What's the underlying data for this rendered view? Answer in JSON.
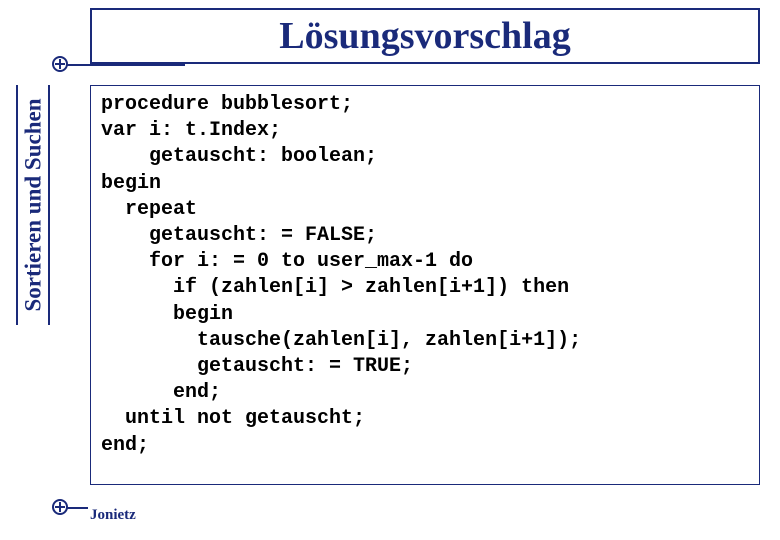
{
  "title": "Lösungsvorschlag",
  "side_label": "Sortieren und Suchen",
  "footer": "Jonietz",
  "code": {
    "l0": "procedure bubblesort;",
    "l1": "var i: t.Index;",
    "l2": "    getauscht: boolean;",
    "l3": "begin",
    "l4": "  repeat",
    "l5": "    getauscht: = FALSE;",
    "l6": "    for i: = 0 to user_max-1 do",
    "l7": "      if (zahlen[i] > zahlen[i+1]) then",
    "l8": "      begin",
    "l9": "        tausche(zahlen[i], zahlen[i+1]);",
    "l10": "        getauscht: = TRUE;",
    "l11": "      end;",
    "l12": "  until not getauscht;",
    "l13": "end;"
  }
}
